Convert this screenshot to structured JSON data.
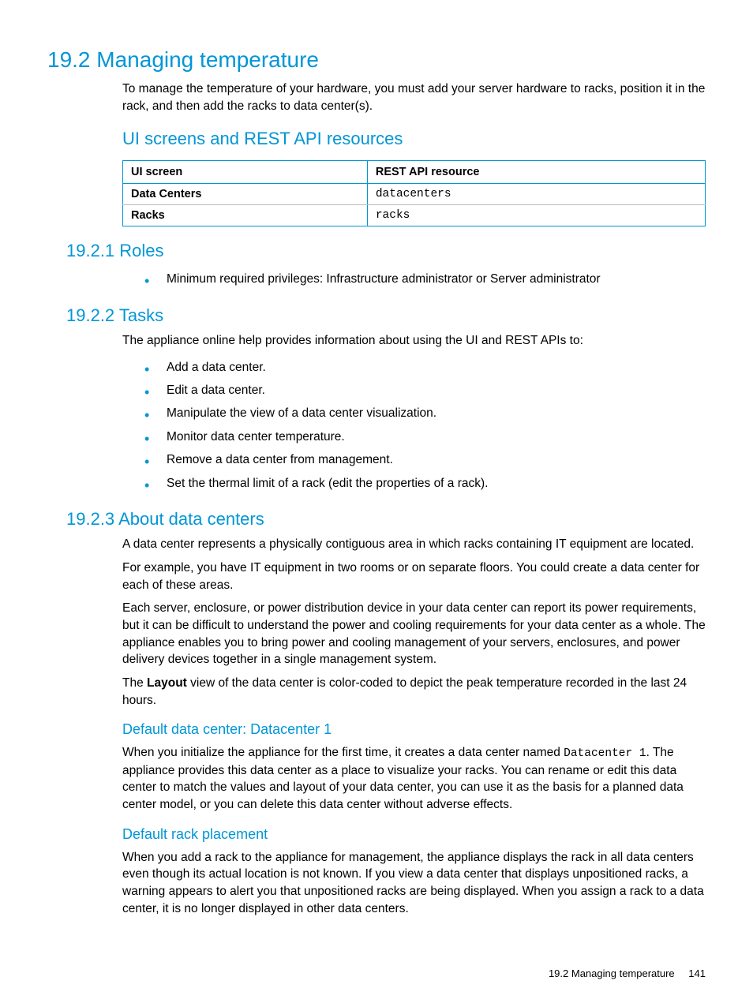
{
  "section": {
    "number_title": "19.2 Managing temperature",
    "intro": "To manage the temperature of your hardware, you must add your server hardware to racks, position it in the rack, and then add the racks to data center(s)."
  },
  "ui_rest": {
    "heading": "UI screens and REST API resources",
    "table": {
      "headers": [
        "UI screen",
        "REST API resource"
      ],
      "rows": [
        {
          "ui": "Data Centers",
          "api": "datacenters"
        },
        {
          "ui": "Racks",
          "api": "racks"
        }
      ]
    }
  },
  "roles": {
    "heading": "19.2.1 Roles",
    "item": "Minimum required privileges: Infrastructure administrator or Server administrator"
  },
  "tasks": {
    "heading": "19.2.2 Tasks",
    "intro": "The appliance online help provides information about using the UI and REST APIs to:",
    "items": [
      "Add a data center.",
      "Edit a data center.",
      "Manipulate the view of a data center visualization.",
      "Monitor data center temperature.",
      "Remove a data center from management.",
      "Set the thermal limit of a rack (edit the properties of a rack)."
    ]
  },
  "about": {
    "heading": "19.2.3 About data centers",
    "p1": "A data center represents a physically contiguous area in which racks containing IT equipment are located.",
    "p2": "For example, you have IT equipment in two rooms or on separate floors. You could create a data center for each of these areas.",
    "p3": "Each server, enclosure, or power distribution device in your data center can report its power requirements, but it can be difficult to understand the power and cooling requirements for your data center as a whole. The appliance enables you to bring power and cooling management of your servers, enclosures, and power delivery devices together in a single management system.",
    "p4_pre": "The ",
    "p4_strong": "Layout",
    "p4_post": " view of the data center is color-coded to depict the peak temperature recorded in the last 24 hours.",
    "default_dc_heading": "Default data center: Datacenter 1",
    "default_dc_pre": "When you initialize the appliance for the first time, it creates a data center named ",
    "default_dc_mono": "Datacenter 1",
    "default_dc_post": ". The appliance provides this data center as a place to visualize your racks. You can rename or edit this data center to match the values and layout of your data center, you can use it as the basis for a planned data center model, or you can delete this data center without adverse effects.",
    "rack_heading": "Default rack placement",
    "rack_p": "When you add a rack to the appliance for management, the appliance displays the rack in all data centers even though its actual location is not known. If you view a data center that displays unpositioned racks, a warning appears to alert you that unpositioned racks are being displayed. When you assign a rack to a data center, it is no longer displayed in other data centers."
  },
  "footer": {
    "text": "19.2 Managing temperature",
    "page": "141"
  }
}
